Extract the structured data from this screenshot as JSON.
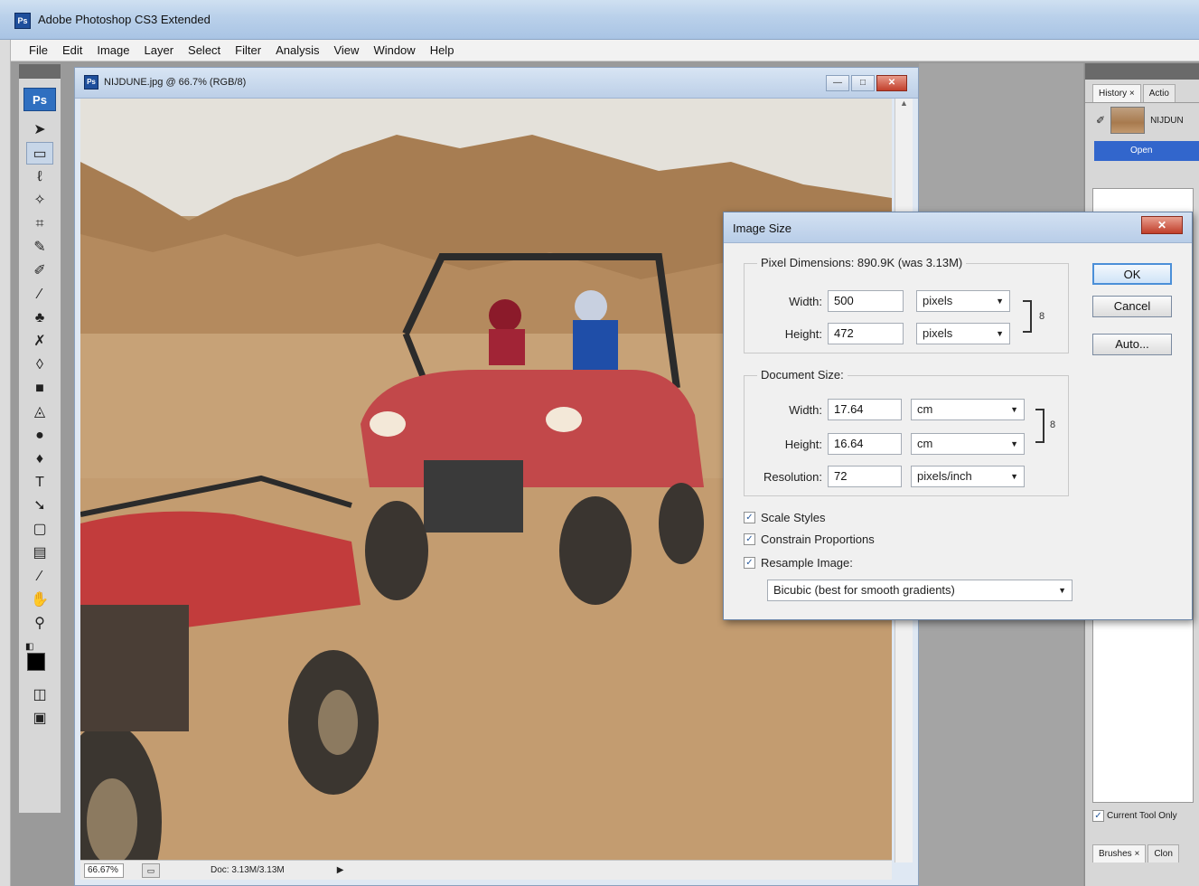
{
  "app": {
    "title": "Adobe Photoshop CS3 Extended",
    "icon_label": "Ps"
  },
  "menu": [
    "File",
    "Edit",
    "Image",
    "Layer",
    "Select",
    "Filter",
    "Analysis",
    "View",
    "Window",
    "Help"
  ],
  "toolbox": {
    "logo": "Ps",
    "tools": [
      {
        "icon": "move-icon",
        "glyph": "➤"
      },
      {
        "icon": "marquee-icon",
        "glyph": "▭"
      },
      {
        "icon": "lasso-icon",
        "glyph": "ℓ"
      },
      {
        "icon": "magic-wand-icon",
        "glyph": "✧"
      },
      {
        "icon": "crop-icon",
        "glyph": "⌗"
      },
      {
        "icon": "slice-icon",
        "glyph": "✎"
      },
      {
        "icon": "healing-brush-icon",
        "glyph": "✐"
      },
      {
        "icon": "brush-icon",
        "glyph": "⁄"
      },
      {
        "icon": "clone-stamp-icon",
        "glyph": "♣"
      },
      {
        "icon": "history-brush-icon",
        "glyph": "✗"
      },
      {
        "icon": "eraser-icon",
        "glyph": "◊"
      },
      {
        "icon": "gradient-icon",
        "glyph": "■"
      },
      {
        "icon": "blur-icon",
        "glyph": "◬"
      },
      {
        "icon": "dodge-icon",
        "glyph": "●"
      },
      {
        "icon": "pen-icon",
        "glyph": "♦"
      },
      {
        "icon": "type-icon",
        "glyph": "T"
      },
      {
        "icon": "path-selection-icon",
        "glyph": "➘"
      },
      {
        "icon": "shape-icon",
        "glyph": "▢"
      },
      {
        "icon": "notes-icon",
        "glyph": "▤"
      },
      {
        "icon": "eyedropper-icon",
        "glyph": "⁄"
      },
      {
        "icon": "hand-icon",
        "glyph": "✋"
      },
      {
        "icon": "zoom-icon",
        "glyph": "⚲"
      }
    ],
    "selected_tool_index": 1
  },
  "document": {
    "title": "NIJDUNE.jpg @ 66.7% (RGB/8)",
    "zoom": "66.67%",
    "doc_size": "Doc: 3.13M/3.13M",
    "win_buttons": [
      "minimize",
      "maximize",
      "close"
    ]
  },
  "panels": {
    "tabs": [
      "History ×",
      "Actio"
    ],
    "snapshot_label": "NIJDUN",
    "history_state": "Open",
    "current_tool_only": "Current Tool Only",
    "bottom_tabs": [
      "Brushes ×",
      "Clon"
    ]
  },
  "dialog": {
    "title": "Image Size",
    "pixel_dimensions_label": "Pixel Dimensions: 890.9K (was 3.13M)",
    "pixel": {
      "width_label": "Width:",
      "width_value": "500",
      "width_unit": "pixels",
      "height_label": "Height:",
      "height_value": "472",
      "height_unit": "pixels"
    },
    "document_size_label": "Document Size:",
    "docsize": {
      "width_label": "Width:",
      "width_value": "17.64",
      "width_unit": "cm",
      "height_label": "Height:",
      "height_value": "16.64",
      "height_unit": "cm",
      "resolution_label": "Resolution:",
      "resolution_value": "72",
      "resolution_unit": "pixels/inch"
    },
    "buttons": {
      "ok": "OK",
      "cancel": "Cancel",
      "auto": "Auto..."
    },
    "checkboxes": [
      {
        "label": "Scale Styles",
        "checked": true
      },
      {
        "label": "Constrain Proportions",
        "checked": true
      },
      {
        "label": "Resample Image:",
        "checked": true
      }
    ],
    "resample_method": "Bicubic (best for smooth gradients)",
    "close_glyph": "✕",
    "link_glyph": "8"
  }
}
